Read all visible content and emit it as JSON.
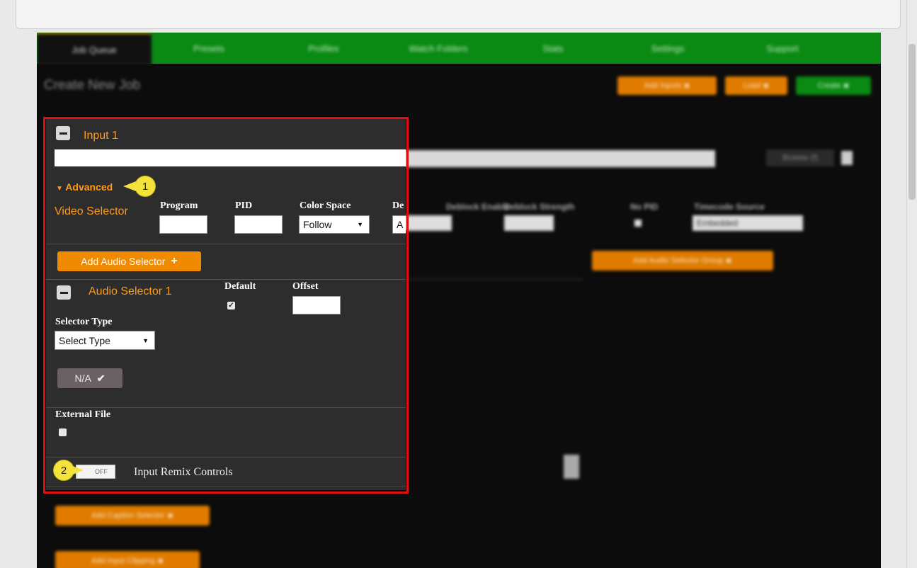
{
  "nav": {
    "items": [
      "Job Queue",
      "Presets",
      "Profiles",
      "Watch Folders",
      "Stats",
      "Settings",
      "Support"
    ]
  },
  "header": {
    "title": "Create New Job",
    "buttons": [
      "Add Inputs",
      "Load",
      "Create"
    ]
  },
  "input": {
    "title": "Input 1",
    "browse_label": "Browse (f)",
    "advanced_label": "Advanced",
    "video_selector": {
      "label": "Video Selector",
      "program_label": "Program",
      "pid_label": "PID",
      "color_space_label": "Color Space",
      "color_space_value": "Follow",
      "deblock_label": "De",
      "deblock_value": "A",
      "deblock_filter_label": "Deblock Enable",
      "filter_strength_label": "Deblock Strength",
      "no_pid_label": "No PID",
      "timecode_label": "Timecode Source",
      "timecode_value": "Embedded"
    },
    "add_audio_selector_label": "Add Audio Selector",
    "add_audio_group_label": "Add Audio Selector Group",
    "audio_selector": {
      "title": "Audio Selector 1",
      "default_label": "Default",
      "default_checked": true,
      "offset_label": "Offset",
      "selector_type_label": "Selector Type",
      "selector_type_value": "Select Type",
      "na_label": "N/A"
    },
    "external_file_label": "External File",
    "remix": {
      "toggle_label": "OFF",
      "label": "Input Remix Controls"
    },
    "add_caption_selector_label": "Add Caption Selector",
    "add_input_clipping_label": "Add Input Clipping"
  },
  "callouts": [
    "1",
    "2"
  ],
  "colors": {
    "accent": "#ff9a1a",
    "nav_green": "#0a8a12",
    "highlight": "#e01010"
  }
}
